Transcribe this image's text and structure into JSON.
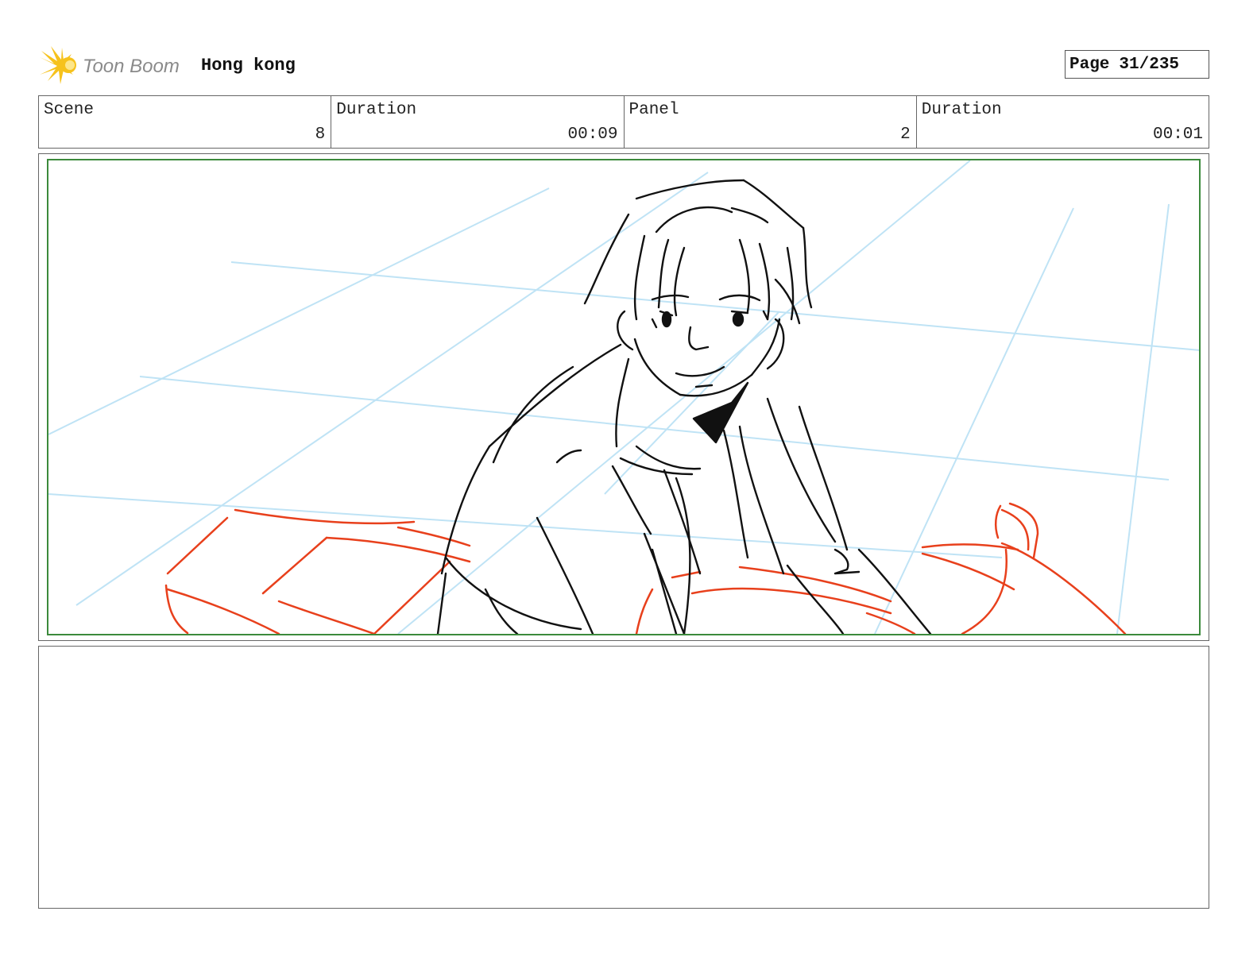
{
  "header": {
    "logo_text": "Toon Boom",
    "project_title": "Hong kong",
    "page_label": "Page",
    "page_number": "31/235"
  },
  "info": {
    "scene_label": "Scene",
    "scene_value": "8",
    "scene_duration_label": "Duration",
    "scene_duration_value": "00:09",
    "panel_label": "Panel",
    "panel_value": "2",
    "panel_duration_label": "Duration",
    "panel_duration_value": "00:01"
  },
  "colors": {
    "frame_border": "#3c8a3c",
    "sketch_line": "#111111",
    "guide_line": "#bfe3f5",
    "red_sketch": "#e8401c",
    "logo_yellow": "#f6c21c",
    "logo_gray": "#8a8a8a"
  },
  "panel": {
    "image": "storyboard-sketch-boy-leaning-over-car"
  },
  "notes": {
    "dialogue": ""
  }
}
